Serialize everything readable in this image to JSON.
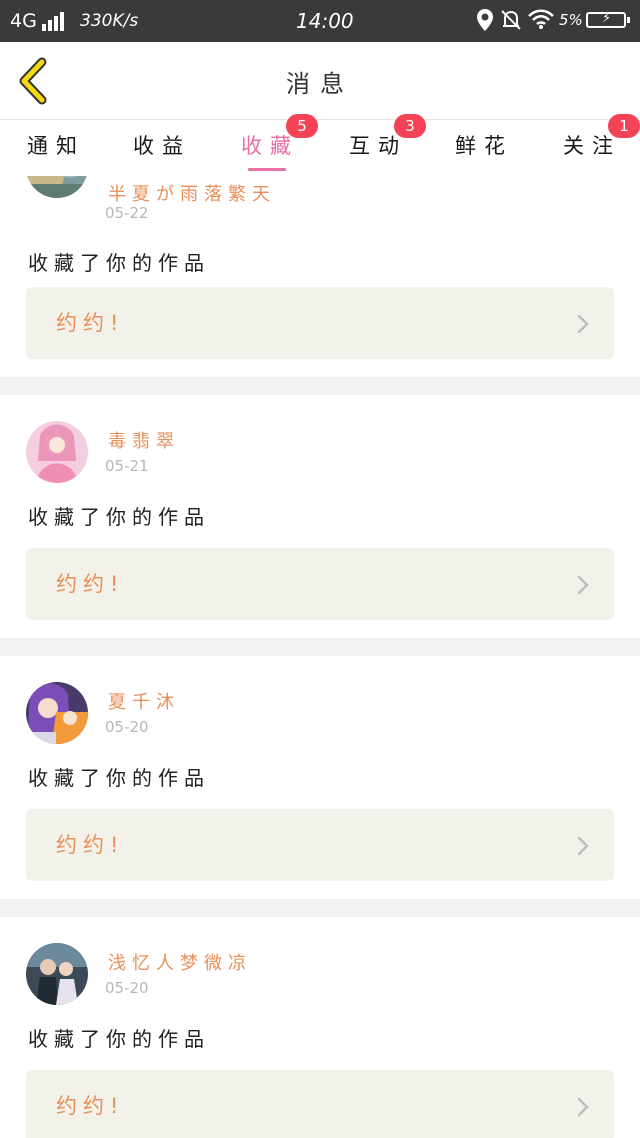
{
  "status_bar": {
    "network": "4G",
    "speed": "330K/s",
    "time": "14:00",
    "battery": "5%"
  },
  "header": {
    "title": "消息",
    "back_icon": "chevron-left-icon",
    "accent": "#f5d90a"
  },
  "tabs": [
    {
      "label": "通知",
      "badge": ""
    },
    {
      "label": "收益",
      "badge": ""
    },
    {
      "label": "收藏",
      "badge": "5",
      "active": true
    },
    {
      "label": "互动",
      "badge": "3"
    },
    {
      "label": "鲜花",
      "badge": ""
    },
    {
      "label": "关注",
      "badge": "1"
    }
  ],
  "messages": [
    {
      "name": "半夏が雨落繁天",
      "date": "05-22",
      "text": "收藏了你的作品",
      "quote": "约约!"
    },
    {
      "name": "毒翡翠",
      "date": "05-21",
      "text": "收藏了你的作品",
      "quote": "约约!"
    },
    {
      "name": "夏千沐",
      "date": "05-20",
      "text": "收藏了你的作品",
      "quote": "约约!"
    },
    {
      "name": "浅忆人梦微凉",
      "date": "05-20",
      "text": "收藏了你的作品",
      "quote": "约约!"
    }
  ],
  "colors": {
    "tab_active": "#e86ea4",
    "badge": "#f44357",
    "username": "#e98f59",
    "quote_bg": "#f3f2ea"
  }
}
